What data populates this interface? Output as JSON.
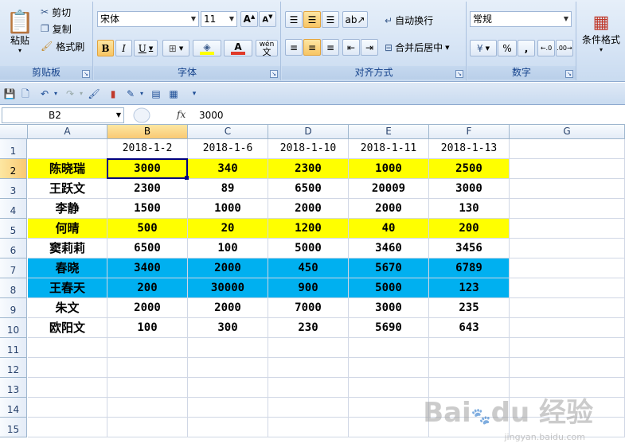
{
  "ribbon": {
    "clipboard": {
      "paste": "粘贴",
      "cut": "剪切",
      "copy": "复制",
      "format_painter": "格式刷",
      "label": "剪贴板"
    },
    "font": {
      "family": "宋体",
      "size": "11",
      "label": "字体",
      "bold": "B",
      "italic": "I",
      "underline": "U",
      "phonetic": "wén",
      "font_color": "#e03a2a",
      "fill_color": "#ffff00"
    },
    "alignment": {
      "wrap_text": "自动换行",
      "merge_center": "合并后居中",
      "label": "对齐方式"
    },
    "number": {
      "format": "常规",
      "percent": "%",
      "comma": ",",
      "label": "数字"
    },
    "styles": {
      "conditional_format": "条件格式"
    }
  },
  "formula_bar": {
    "name_box": "B2",
    "fx": "fx",
    "value": "3000"
  },
  "sheet": {
    "columns": [
      "A",
      "B",
      "C",
      "D",
      "E",
      "F",
      "G"
    ],
    "selected_column": "B",
    "selected_row": 2,
    "rows": [
      1,
      2,
      3,
      4,
      5,
      6,
      7,
      8,
      9,
      10,
      11,
      12,
      13,
      14,
      15
    ],
    "headers": [
      "2018-1-2",
      "2018-1-6",
      "2018-1-10",
      "2018-1-11",
      "2018-1-13"
    ],
    "data": [
      {
        "name": "陈晓瑞",
        "values": [
          "3000",
          "340",
          "2300",
          "1000",
          "2500"
        ],
        "fill": "#ffff00"
      },
      {
        "name": "王跃文",
        "values": [
          "2300",
          "89",
          "6500",
          "20009",
          "3000"
        ],
        "fill": ""
      },
      {
        "name": "李静",
        "values": [
          "1500",
          "1000",
          "2000",
          "2000",
          "130"
        ],
        "fill": ""
      },
      {
        "name": "何晴",
        "values": [
          "500",
          "20",
          "1200",
          "40",
          "200"
        ],
        "fill": "#ffff00"
      },
      {
        "name": "窦莉莉",
        "values": [
          "6500",
          "100",
          "5000",
          "3460",
          "3456"
        ],
        "fill": ""
      },
      {
        "name": "春晓",
        "values": [
          "3400",
          "2000",
          "450",
          "5670",
          "6789"
        ],
        "fill": "#00b0f0"
      },
      {
        "name": "王春天",
        "values": [
          "200",
          "30000",
          "900",
          "5000",
          "123"
        ],
        "fill": "#00b0f0"
      },
      {
        "name": "朱文",
        "values": [
          "2000",
          "2000",
          "7000",
          "3000",
          "235"
        ],
        "fill": ""
      },
      {
        "name": "欧阳文",
        "values": [
          "100",
          "300",
          "230",
          "5690",
          "643"
        ],
        "fill": ""
      }
    ]
  },
  "watermark": {
    "brand": "Bai du 经验",
    "url": "jingyan.baidu.com"
  }
}
